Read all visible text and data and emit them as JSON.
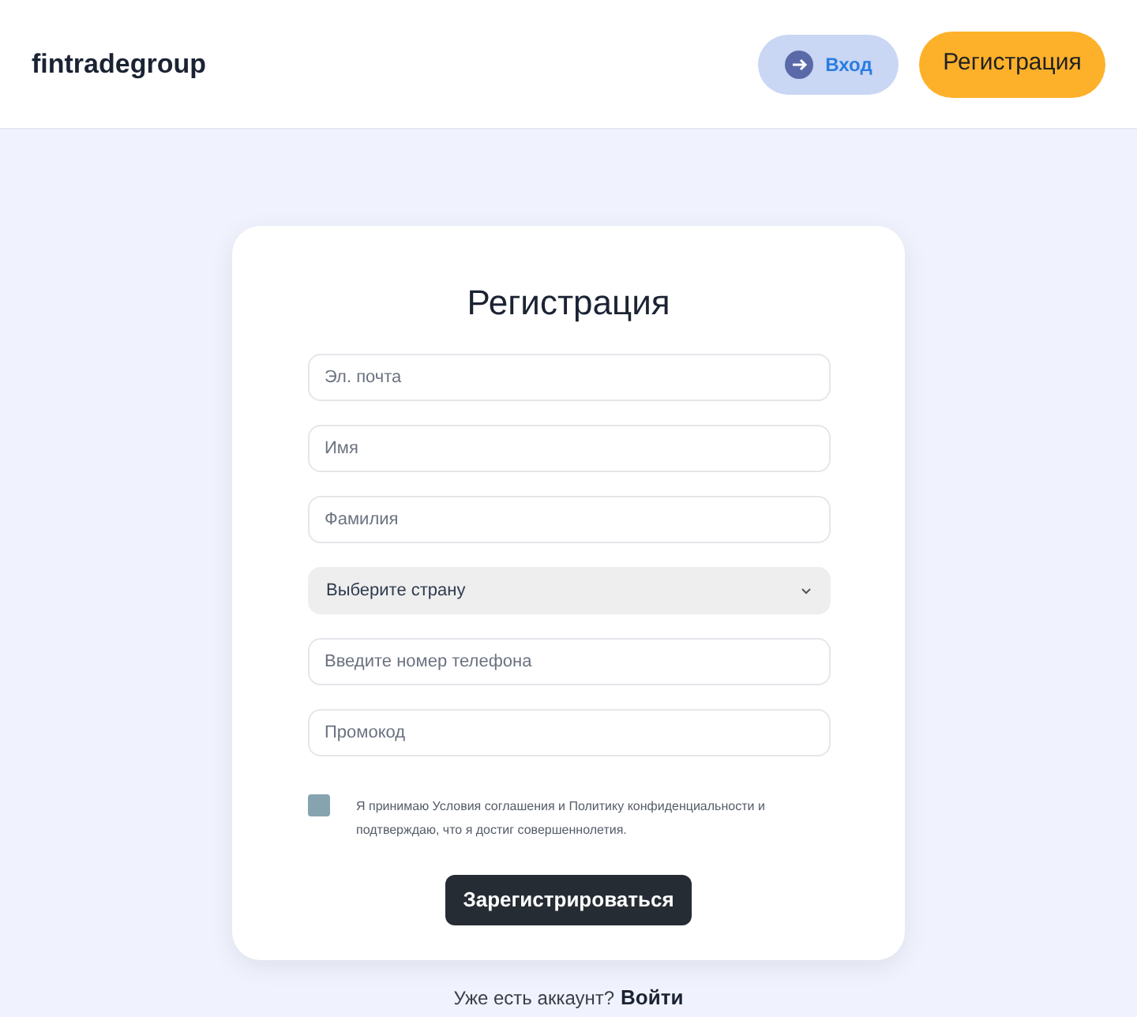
{
  "header": {
    "logo": "fintradegroup",
    "login_button": "Вход",
    "register_button": "Регистрация"
  },
  "form": {
    "title": "Регистрация",
    "fields": [
      {
        "kind": "input",
        "placeholder": "Эл. почта"
      },
      {
        "kind": "input",
        "placeholder": "Имя"
      },
      {
        "kind": "input",
        "placeholder": "Фамилия"
      },
      {
        "kind": "select",
        "value": "Выберите страну"
      },
      {
        "kind": "input",
        "placeholder": "Введите номер телефона"
      },
      {
        "kind": "input",
        "placeholder": "Промокод"
      }
    ],
    "consent": {
      "checked": false,
      "text": "Я принимаю Условия соглашения и Политику конфиденциальности и подтверждаю, что я достиг совершеннолетия."
    },
    "submit": "Зарегистрироваться"
  },
  "footer": {
    "question": "Уже есть аккаунт?",
    "link": "Войти"
  }
}
